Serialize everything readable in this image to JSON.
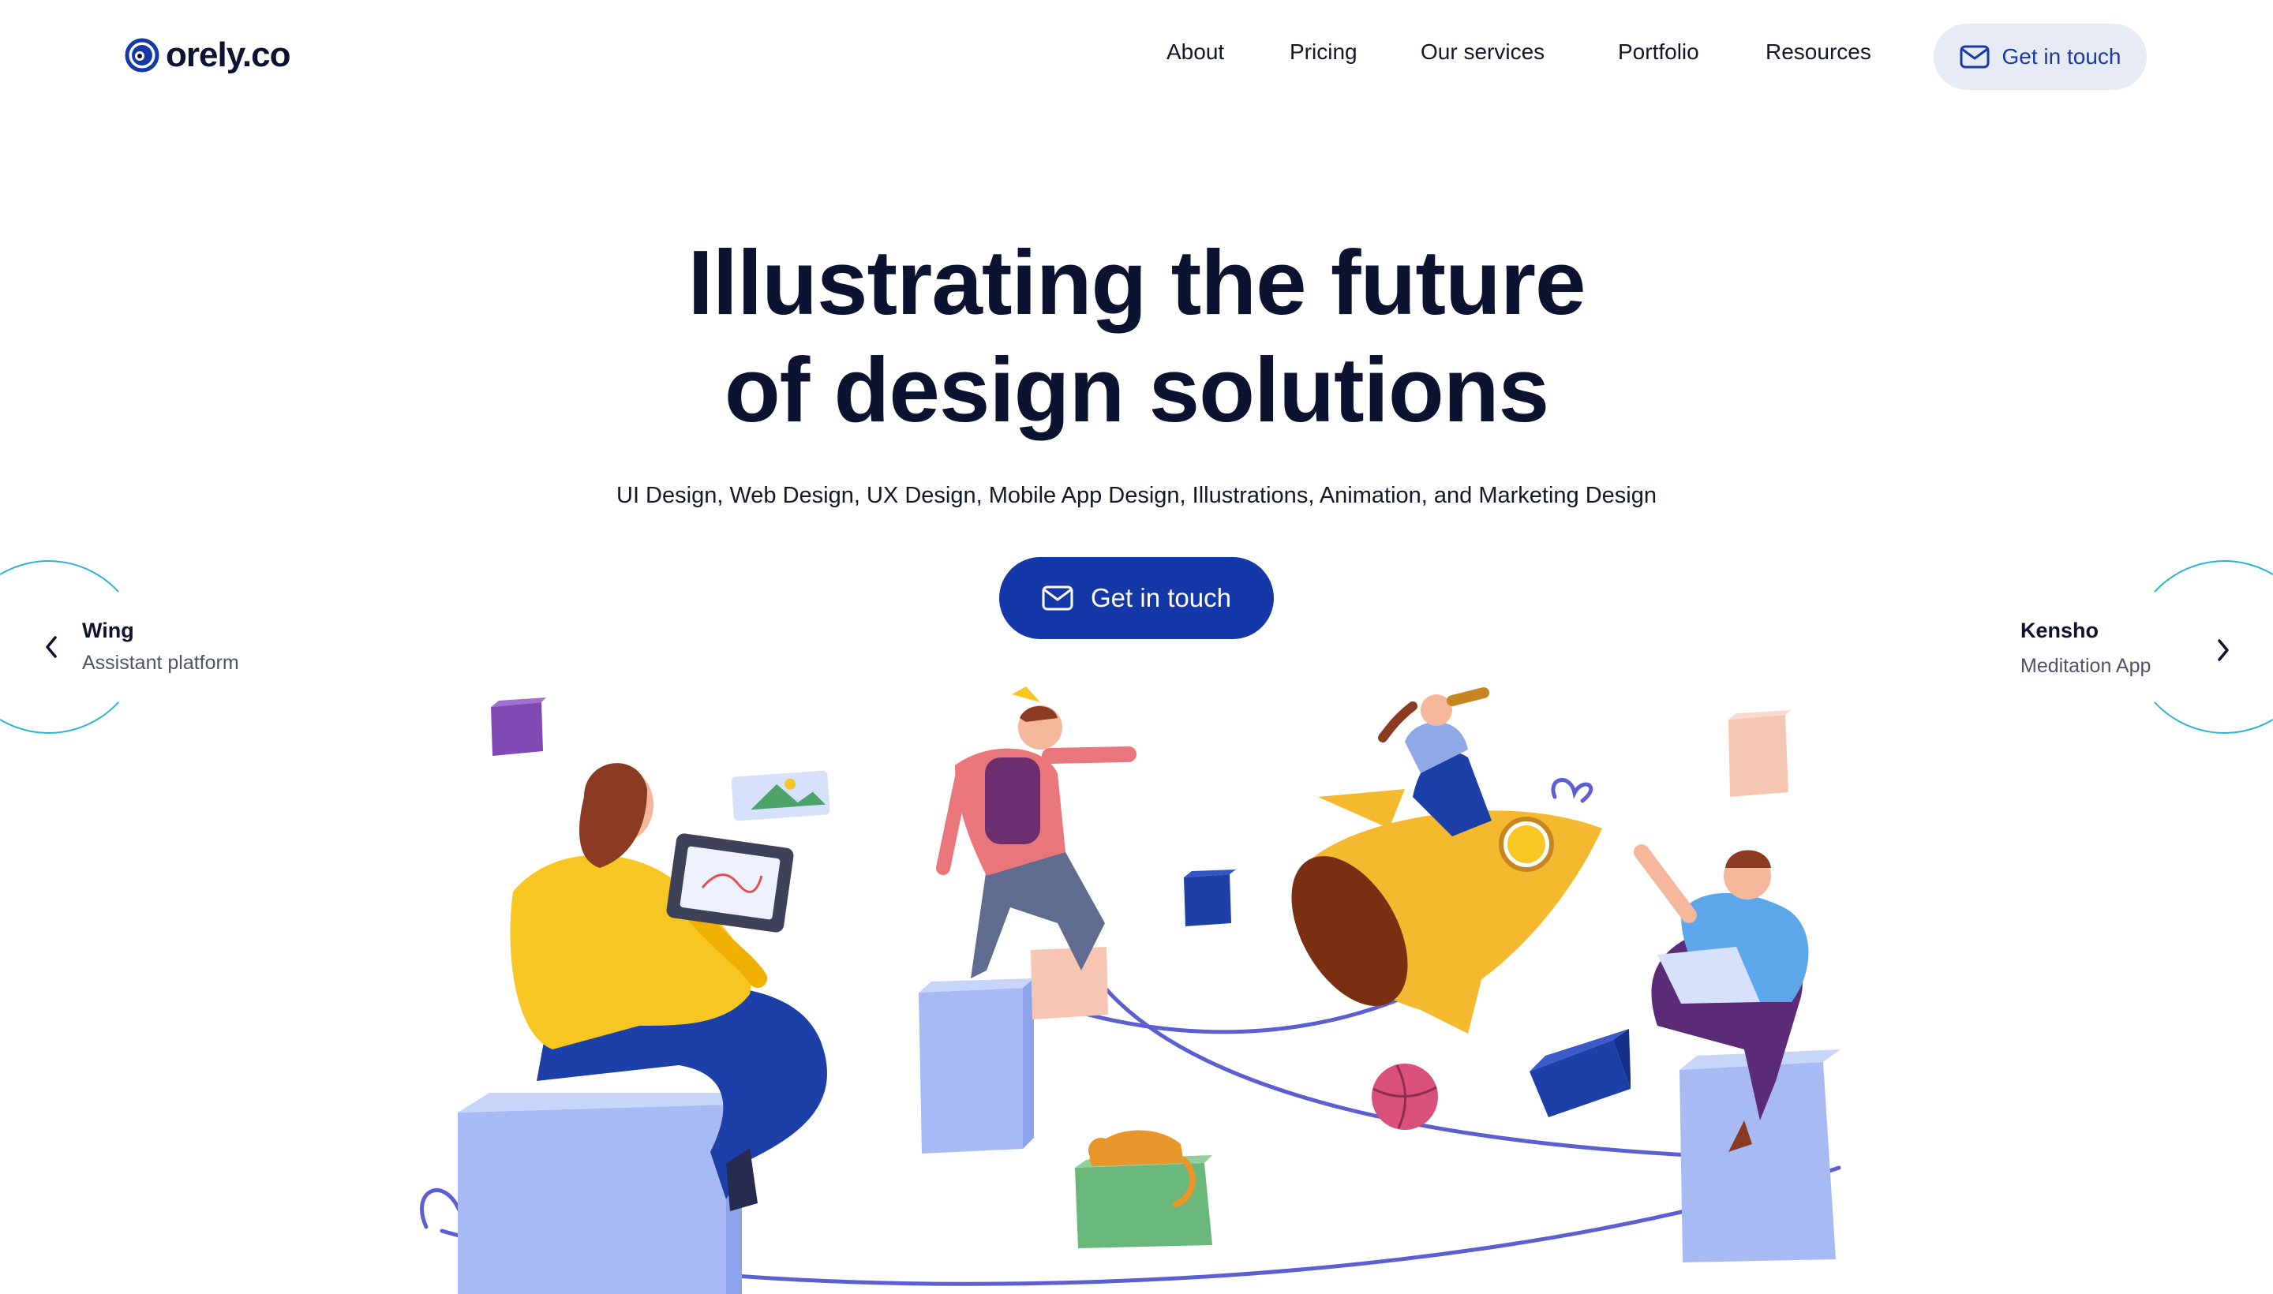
{
  "brand": {
    "name": "orely.co",
    "accent": "#1538a8",
    "accent_light": "#e7ebf6"
  },
  "icons": {
    "logo": "eye-logo-icon",
    "mail": "mail-icon",
    "prev": "chevron-left-icon",
    "next": "chevron-right-icon"
  },
  "nav": {
    "items": [
      {
        "label": "About"
      },
      {
        "label": "Pricing"
      },
      {
        "label": "Our services"
      },
      {
        "label": "Portfolio"
      },
      {
        "label": "Resources"
      }
    ],
    "cta_label": "Get in touch"
  },
  "hero": {
    "title_line1": "Illustrating the future",
    "title_line2": "of design solutions",
    "subtitle": "UI Design, Web Design, UX Design, Mobile App Design, Illustrations, Animation, and Marketing Design",
    "cta_label": "Get in touch"
  },
  "carousel": {
    "prev": {
      "title": "Wing",
      "subtitle": "Assistant platform"
    },
    "next": {
      "title": "Kensho",
      "subtitle": "Meditation App"
    }
  }
}
